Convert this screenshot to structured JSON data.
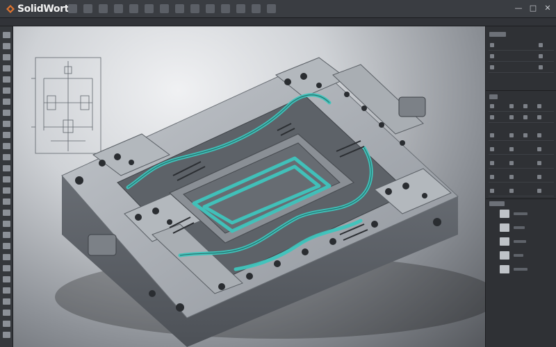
{
  "app": {
    "title": "SolidWorts"
  },
  "colors": {
    "accent": "#e0752f",
    "coolant": "#3fc5bd",
    "metal": "#9aa0a6",
    "panel_bg": "#2f3135",
    "toolbar_bg": "#3a3d42"
  },
  "window_controls": [
    "minimize-icon",
    "maximize-icon",
    "close-icon"
  ],
  "icons": {
    "top_menu": [
      "file-icon",
      "edit-icon",
      "view-icon",
      "insert-icon",
      "tools-icon",
      "window-icon",
      "help-icon",
      "sketch-icon",
      "extrude-icon",
      "cut-icon",
      "fillet-icon",
      "measure-icon",
      "section-icon",
      "render-icon"
    ],
    "left_toolbar": [
      "select-icon",
      "line-icon",
      "rectangle-icon",
      "circle-icon",
      "arc-icon",
      "spline-icon",
      "polygon-icon",
      "trim-icon",
      "extend-icon",
      "offset-icon",
      "mirror-icon",
      "pattern-icon",
      "dimension-icon",
      "relation-icon",
      "point-icon",
      "centerline-icon",
      "text-icon",
      "chamfer-icon",
      "fillet-icon",
      "plane-icon",
      "axis-icon",
      "coordinate-icon",
      "zoom-icon",
      "pan-icon",
      "rotate-icon",
      "grid-icon",
      "layer-icon",
      "color-icon"
    ]
  }
}
